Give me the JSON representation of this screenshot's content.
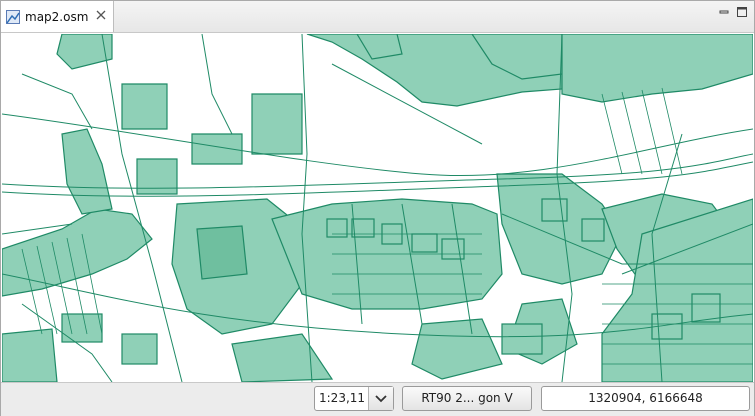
{
  "tab": {
    "title": "map2.osm",
    "icon": "map-file-icon",
    "close_icon": "close-icon"
  },
  "window_controls": [
    "minimize-icon",
    "maximize-icon"
  ],
  "map": {
    "fill_color": "#8fd0b7",
    "line_color": "#1f8a66",
    "background": "#ffffff"
  },
  "statusbar": {
    "scale_value": "1:23,11",
    "scale_dropdown_icon": "chevron-down-icon",
    "crs_label": "RT90 2... gon V",
    "coordinates": "1320904, 6166648"
  }
}
